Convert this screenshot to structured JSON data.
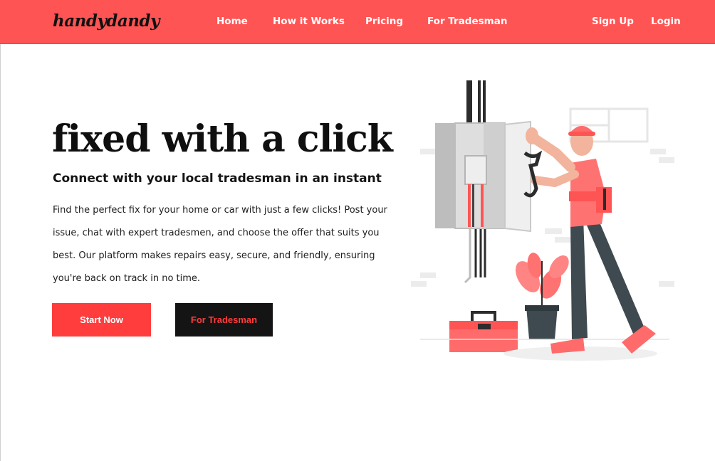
{
  "brand": {
    "logo": "handydandy"
  },
  "nav": {
    "links": [
      "Home",
      "How it Works",
      "Pricing",
      "For Tradesman"
    ],
    "signup": "Sign Up",
    "login": "Login"
  },
  "hero": {
    "title": "fixed with a click",
    "subtitle": "Connect with your local tradesman in an instant",
    "body_lines": [
      "Find the perfect fix for your home or car with just a few clicks! Post  your",
      "issue, chat with expert tradesmen, and choose the offer that suits  you",
      "best. Our platform makes repairs easy, secure, and friendly,  ensuring",
      "you're back on track in no time."
    ],
    "primary_button": "Start Now",
    "secondary_button": "For Tradesman"
  },
  "colors": {
    "accent": "#ff5454",
    "button_primary": "#ff3d3d",
    "button_dark": "#141414"
  },
  "illustration": {
    "subject": "tradesman-fixing-electrical-panel"
  }
}
